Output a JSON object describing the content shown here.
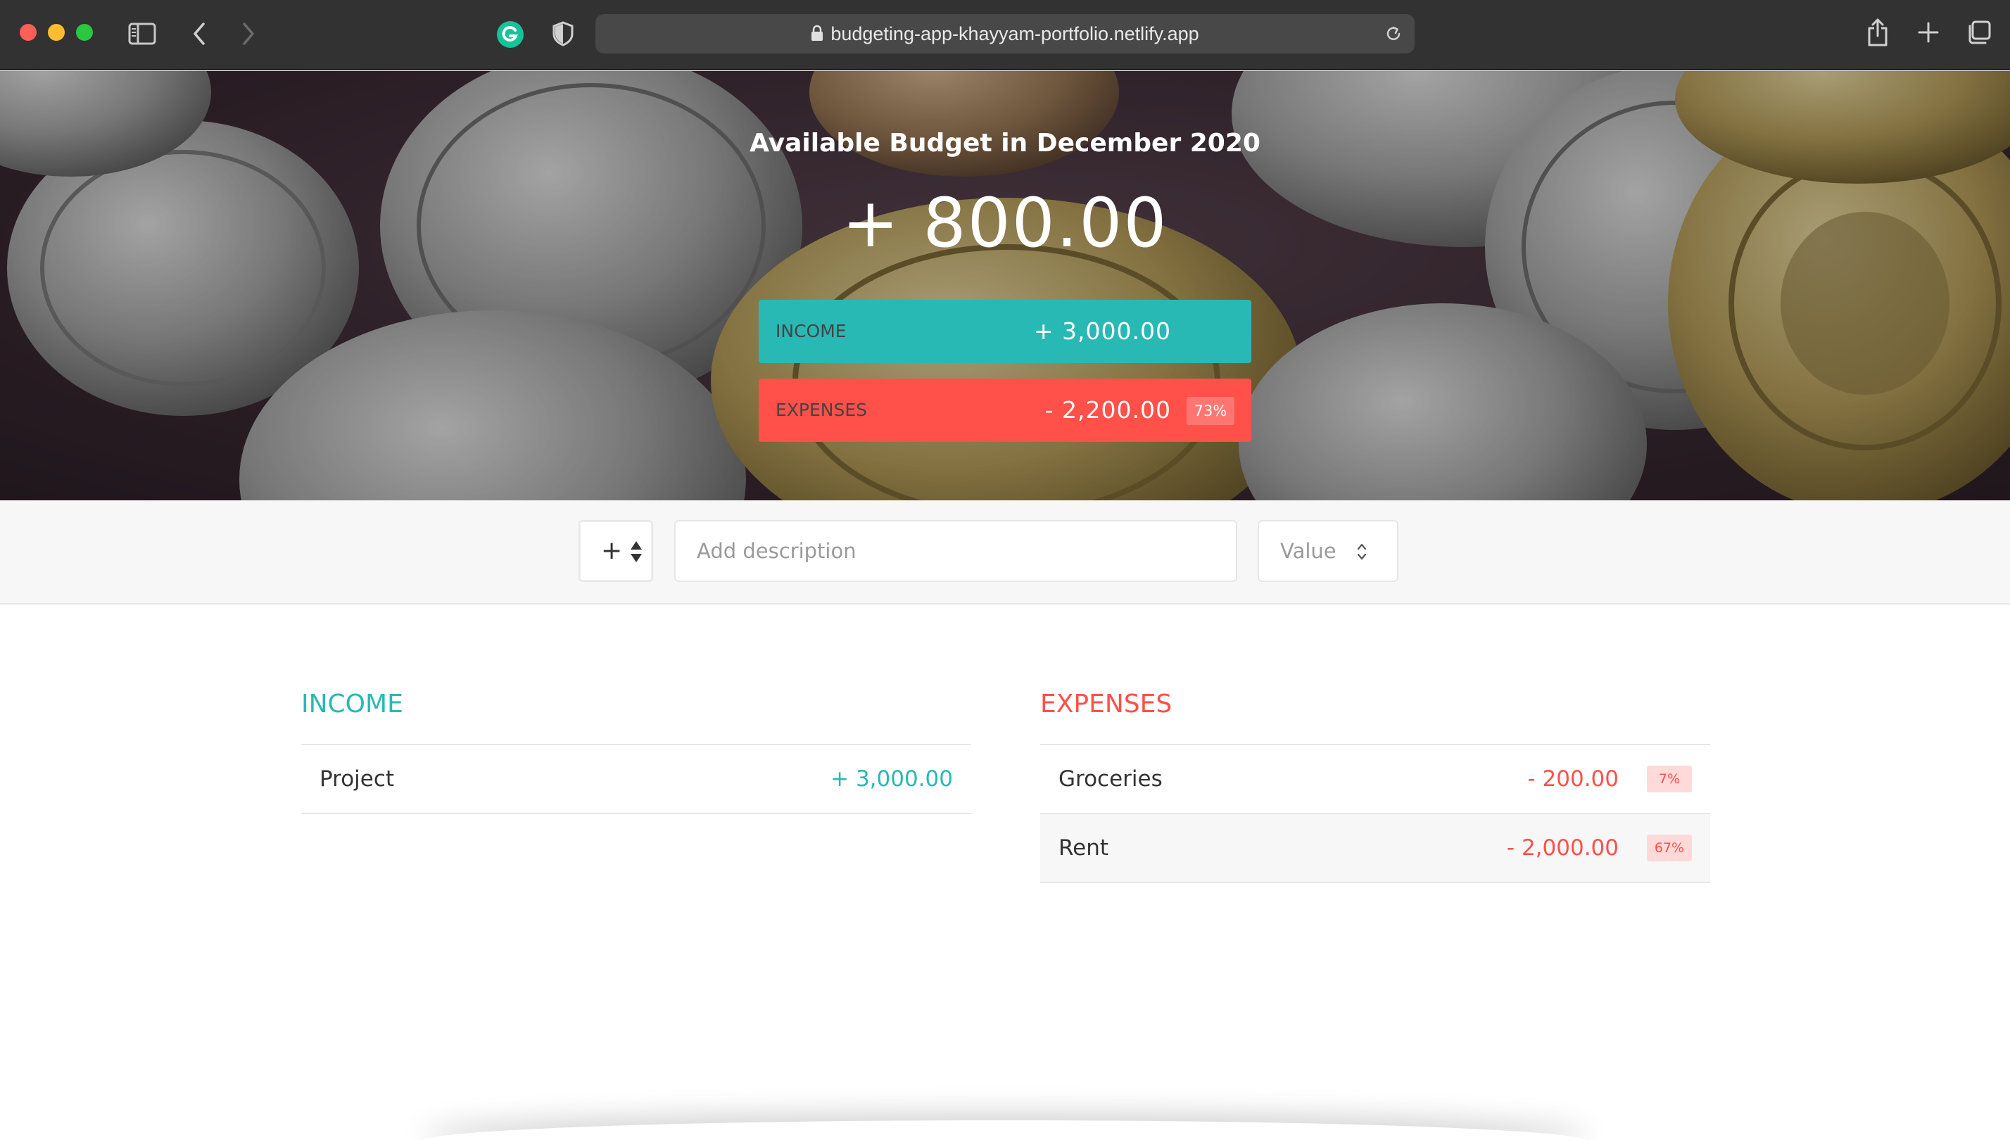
{
  "browser": {
    "url": "budgeting-app-khayyam-portfolio.netlify.app",
    "icons": [
      "sidebar-icon",
      "back-icon",
      "forward-icon",
      "grammarly-icon",
      "shield-icon",
      "lock-icon",
      "reload-icon",
      "share-icon",
      "new-tab-icon",
      "tabs-overview-icon"
    ]
  },
  "hero": {
    "title": "Available Budget in December 2020",
    "budget": "+ 800.00",
    "income_label": "Income",
    "income_value": "+ 3,000.00",
    "expenses_label": "Expenses",
    "expenses_value": "- 2,200.00",
    "expenses_percentage": "73%"
  },
  "add_bar": {
    "type_value": "+",
    "description_placeholder": "Add description",
    "value_placeholder": "Value"
  },
  "income": {
    "title": "Income",
    "items": [
      {
        "description": "Project",
        "value": "+ 3,000.00"
      }
    ]
  },
  "expenses": {
    "title": "Expenses",
    "items": [
      {
        "description": "Groceries",
        "value": "- 200.00",
        "percentage": "7%"
      },
      {
        "description": "Rent",
        "value": "- 2,000.00",
        "percentage": "67%"
      }
    ]
  },
  "colors": {
    "income": "#28b9b5",
    "expenses": "#ff5049",
    "toolbar": "#323232"
  }
}
